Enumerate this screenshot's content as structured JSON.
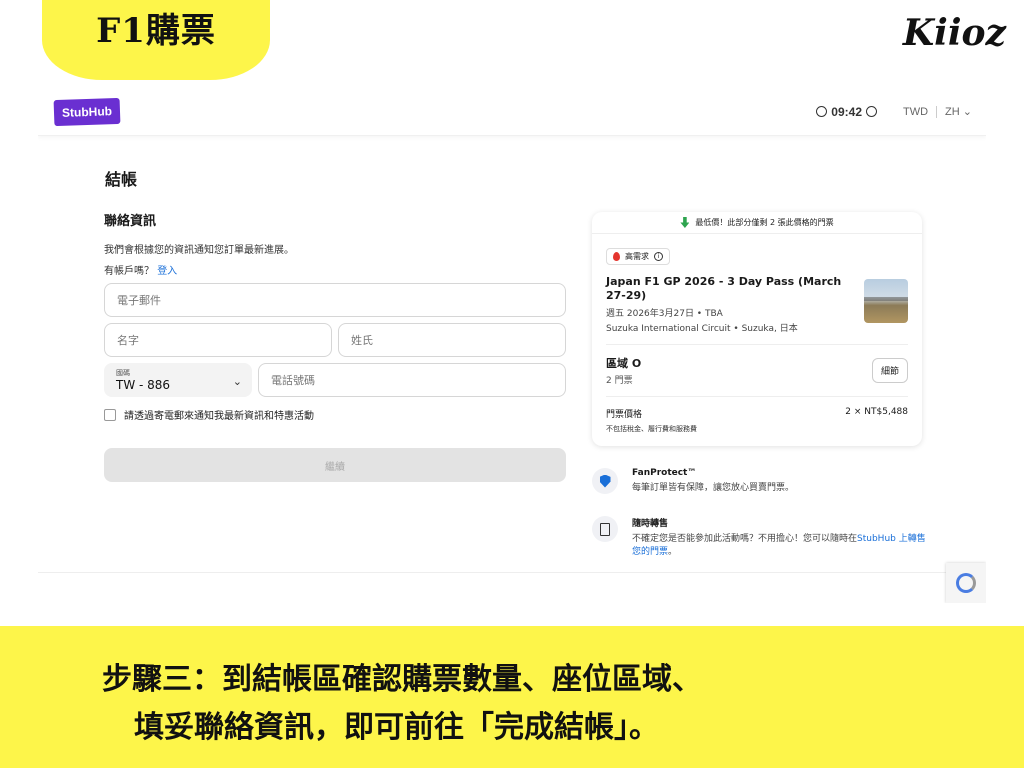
{
  "overlay": {
    "title_tag": "F1購票",
    "signature": "Kiioz",
    "caption_line1": "步驟三：到結帳區確認購票數量、座位區域、",
    "caption_line2": "填妥聯絡資訊，即可前往「完成結帳」。",
    "colors": {
      "highlight": "#fdf54a"
    }
  },
  "header": {
    "logo": "StubHub",
    "timer": "09:42",
    "currency": "TWD",
    "language": "ZH",
    "colors": {
      "brand": "#6a2fd1"
    }
  },
  "checkout": {
    "title": "結帳",
    "contact_heading": "聯絡資訊",
    "contact_note": "我們會根據您的資訊通知您訂單最新進展。",
    "account_question": "有帳戶嗎？",
    "login_link": "登入",
    "email_placeholder": "電子郵件",
    "first_name_placeholder": "名字",
    "last_name_placeholder": "姓氏",
    "country_label": "國碼",
    "country_value": "TW - 886",
    "phone_placeholder": "電話號碼",
    "newsletter_label": "請透過寄電郵來通知我最新資訊和特惠活動",
    "continue_label": "繼續"
  },
  "ticket_card": {
    "best_price_text": "最低價！此部分僅剩 2 張此價格的門票",
    "demand_badge": "高需求",
    "event_title": "Japan F1 GP 2026 - 3 Day Pass (March 27-29)",
    "event_date": "週五 2026年3月27日 • TBA",
    "event_venue": "Suzuka International Circuit • Suzuka, 日本",
    "zone_name": "區域 O",
    "zone_qty": "2 門票",
    "details_button": "細節",
    "price_label": "門票價格",
    "price_value": "2 × NT$5,488",
    "price_note": "不包括稅金、履行費和服務費"
  },
  "features": [
    {
      "title": "FanProtect™",
      "text": "每筆訂單皆有保障，讓您放心買賣門票。",
      "link": ""
    },
    {
      "title": "隨時轉售",
      "text": "不確定您是否能參加此活動嗎？不用擔心！您可以隨時在",
      "link": "StubHub 上轉售您的門票",
      "suffix": "。"
    }
  ]
}
